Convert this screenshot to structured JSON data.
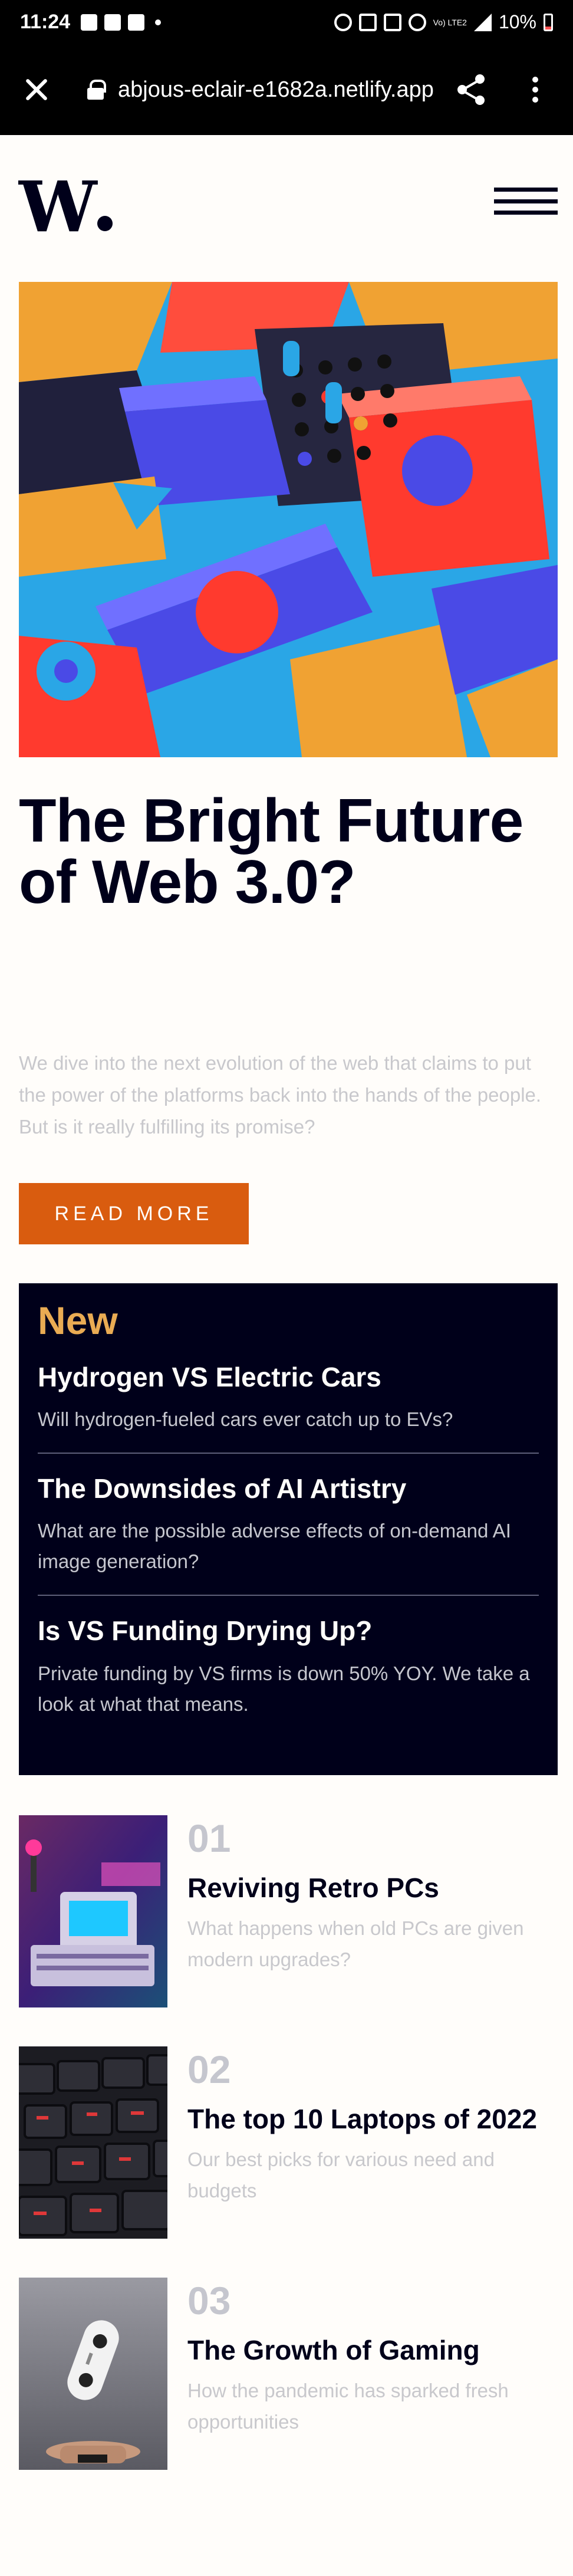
{
  "status_bar": {
    "time": "11:24",
    "battery": "10%",
    "network": "Vo) LTE2",
    "battery_color": "#ff5252"
  },
  "browser": {
    "url": "abjous-eclair-e1682a.netlify.app",
    "icons": [
      "close-icon",
      "lock-icon",
      "share-icon",
      "more-vert-icon"
    ]
  },
  "site": {
    "logo": "W",
    "menu_icon": "hamburger-icon"
  },
  "hero": {
    "headline": "The Bright Future of Web 3.0?",
    "intro": "We dive into the next evolution of the web that claims to put the power of the platforms back into the hands of the people. But is it really fulfilling its promise?",
    "cta": "READ MORE"
  },
  "new_panel": {
    "heading": "New",
    "items": [
      {
        "title": "Hydrogen VS Electric Cars",
        "desc": "Will hydrogen-fueled cars ever catch up to EVs?"
      },
      {
        "title": "The Downsides of AI Artistry",
        "desc": "What are the possible adverse effects of on-demand AI image generation?"
      },
      {
        "title": "Is VS Funding Drying Up?",
        "desc": "Private funding by VS firms is down 50% YOY. We take a look at what that means."
      }
    ]
  },
  "numbered": [
    {
      "num": "01",
      "title": "Reviving Retro PCs",
      "desc": "What happens when old PCs are given modern upgrades?"
    },
    {
      "num": "02",
      "title": "The top 10 Laptops of 2022",
      "desc": "Our best picks for various need and budgets"
    },
    {
      "num": "03",
      "title": "The Growth of Gaming",
      "desc": "How the pandemic has sparked fresh opportunities"
    }
  ],
  "colors": {
    "brand_dark": "#00001a",
    "accent_orange": "#d95c0f",
    "accent_gold": "#e9ab53",
    "muted_text": "#c5c6ce",
    "background": "#fffdfa"
  }
}
